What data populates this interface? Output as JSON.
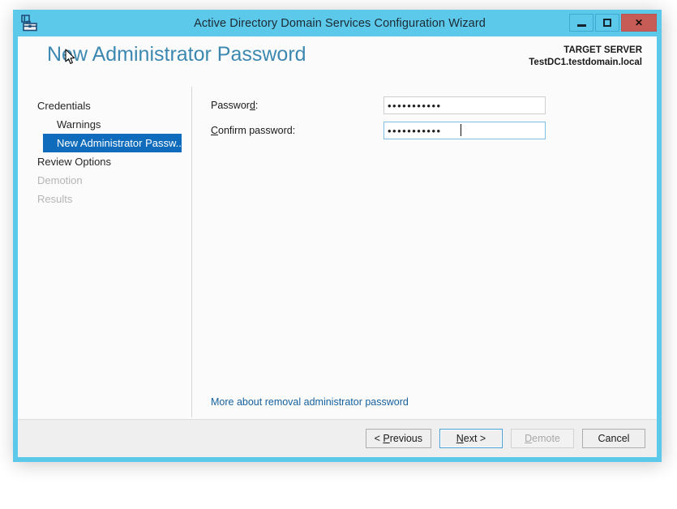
{
  "window": {
    "title": "Active Directory Domain Services Configuration Wizard",
    "icon": "server-manager-toolbox-icon",
    "controls": {
      "minimize": "minimize-icon",
      "maximize": "maximize-icon",
      "close": "✕"
    },
    "frame_color": "#5cc8ea"
  },
  "header": {
    "page_title": "New Administrator Password",
    "target_server_label": "TARGET SERVER",
    "target_server_name": "TestDC1.testdomain.local",
    "title_color": "#3d88b0"
  },
  "nav": {
    "items": [
      {
        "label": "Credentials",
        "state": "enabled",
        "indent": false
      },
      {
        "label": "Warnings",
        "state": "enabled",
        "indent": true
      },
      {
        "label": "New Administrator Passw...",
        "state": "selected",
        "indent": false
      },
      {
        "label": "Review Options",
        "state": "enabled",
        "indent": false
      },
      {
        "label": "Demotion",
        "state": "disabled",
        "indent": false
      },
      {
        "label": "Results",
        "state": "disabled",
        "indent": false
      }
    ],
    "selected_color": "#0f6cbd"
  },
  "form": {
    "password": {
      "label_before": "Passwor",
      "label_accesskey": "d",
      "label_after": ":",
      "value": "•••••••••••",
      "placeholder": "",
      "focused": false
    },
    "confirm_password": {
      "label_before": "",
      "label_accesskey": "C",
      "label_after": "onfirm password:",
      "value": "•••••••••••",
      "placeholder": "",
      "focused": true
    },
    "more_link": "More about removal administrator password",
    "link_color": "#16619e"
  },
  "footer": {
    "buttons": [
      {
        "name": "previous",
        "before": "< ",
        "accesskey": "P",
        "after": "revious",
        "state": "enabled"
      },
      {
        "name": "next",
        "before": "",
        "accesskey": "N",
        "after": "ext >",
        "state": "default"
      },
      {
        "name": "demote",
        "before": "",
        "accesskey": "D",
        "after": "emote",
        "state": "disabled"
      },
      {
        "name": "cancel",
        "before": "Cancel",
        "accesskey": "",
        "after": "",
        "state": "enabled"
      }
    ]
  }
}
